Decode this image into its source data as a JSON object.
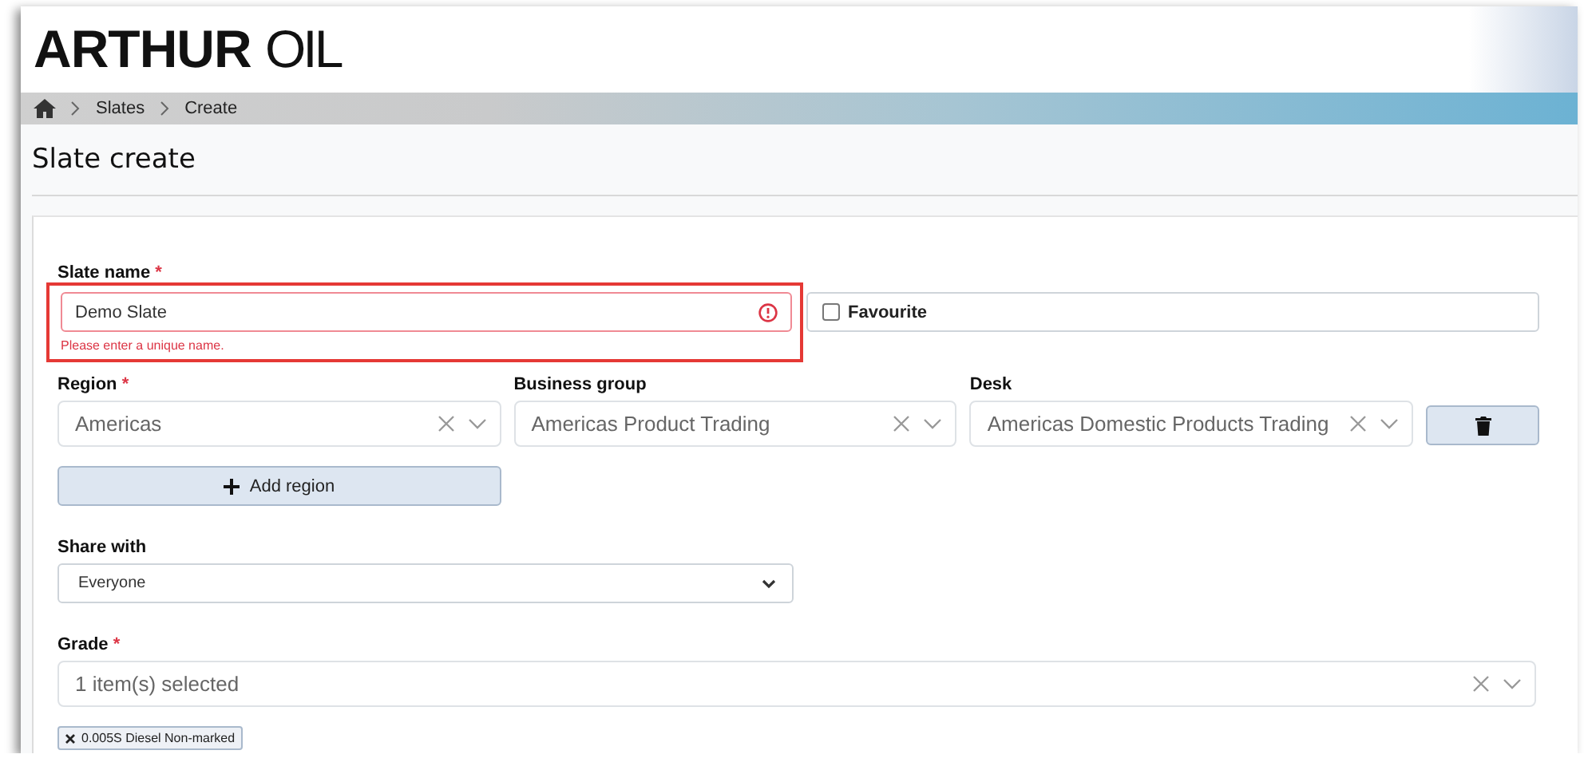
{
  "brand": {
    "bold": "ARTHUR",
    "light": "OIL"
  },
  "breadcrumbs": [
    {
      "label": "Slates"
    },
    {
      "label": "Create"
    }
  ],
  "page_title": "Slate create",
  "form": {
    "slate_name": {
      "label": "Slate name",
      "required_mark": "*",
      "value": "Demo Slate",
      "invalid": true,
      "error": "Please enter a unique name."
    },
    "favourite": {
      "label": "Favourite",
      "checked": false
    },
    "region_rows": [
      {
        "fields": [
          {
            "label": "Region",
            "required_mark": "*",
            "value": "Americas"
          },
          {
            "label": "Business group",
            "value": "Americas Product Trading"
          },
          {
            "label": "Desk",
            "value": "Americas Domestic Products Trading"
          }
        ]
      }
    ],
    "add_region_button": "Add region",
    "share_with": {
      "label": "Share with",
      "value": "Everyone"
    },
    "grade": {
      "label": "Grade",
      "required_mark": "*",
      "summary": "1 item(s) selected",
      "chips": [
        "0.005S Diesel Non-marked"
      ]
    }
  }
}
